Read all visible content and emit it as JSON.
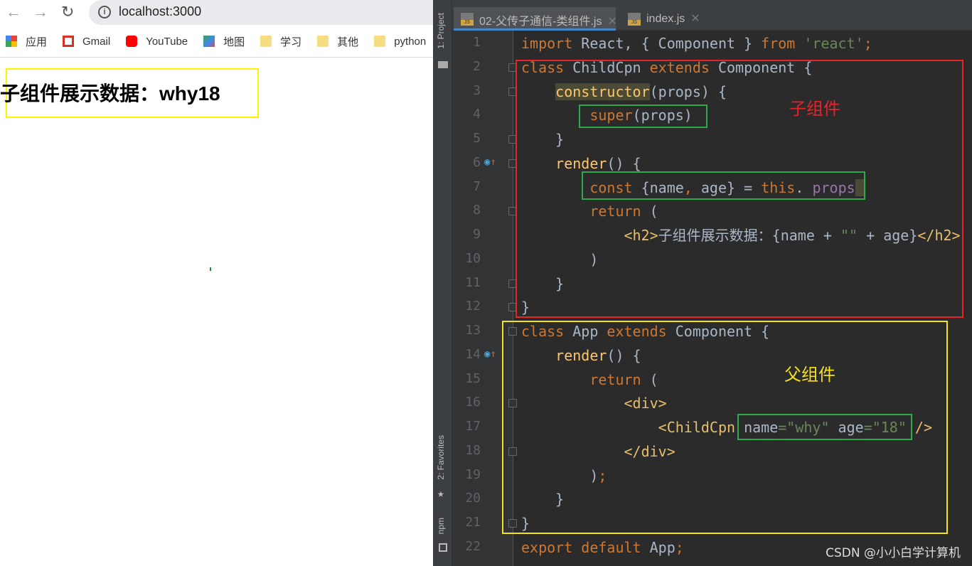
{
  "browser": {
    "url": "localhost:3000",
    "bookmarks": [
      {
        "label": "应用",
        "icon": "apps-icon"
      },
      {
        "label": "Gmail",
        "icon": "gmail-icon"
      },
      {
        "label": "YouTube",
        "icon": "youtube-icon"
      },
      {
        "label": "地图",
        "icon": "maps-icon"
      },
      {
        "label": "学习",
        "icon": "folder-icon"
      },
      {
        "label": "其他",
        "icon": "folder-icon"
      },
      {
        "label": "python",
        "icon": "folder-icon"
      }
    ],
    "page_heading": "子组件展示数据：why18"
  },
  "ide": {
    "side_labels": {
      "project": "1: Project",
      "favorites": "2: Favorites",
      "npm": "npm"
    },
    "tabs": [
      {
        "label": "02-父传子通信-类组件.js",
        "active": true
      },
      {
        "label": "index.js",
        "active": false
      }
    ],
    "lines": [
      [
        [
          "k",
          "import "
        ],
        [
          "",
          "React, { Component } "
        ],
        [
          "k",
          "from "
        ],
        [
          "s",
          "'react'"
        ],
        [
          "k",
          ";"
        ]
      ],
      [
        [
          "k",
          "class "
        ],
        [
          "",
          "ChildCpn "
        ],
        [
          "k",
          "extends "
        ],
        [
          "",
          "Component {"
        ]
      ],
      [
        [
          "",
          "    "
        ],
        [
          "f hl",
          "constructor"
        ],
        [
          "",
          "(props) {"
        ]
      ],
      [
        [
          "",
          "        "
        ],
        [
          "k",
          "super"
        ],
        [
          "",
          "(props)"
        ]
      ],
      [
        [
          "",
          "    }"
        ]
      ],
      [
        [
          "",
          "    "
        ],
        [
          "f",
          "render"
        ],
        [
          "",
          "() {"
        ]
      ],
      [
        [
          "",
          "        "
        ],
        [
          "k",
          "const "
        ],
        [
          "",
          "{name"
        ],
        [
          "k",
          ", "
        ],
        [
          "",
          "age} = "
        ],
        [
          "k",
          "this"
        ],
        [
          "",
          ". "
        ],
        [
          "p",
          "props"
        ],
        [
          "hl",
          " "
        ]
      ],
      [
        [
          "",
          "        "
        ],
        [
          "k",
          "return "
        ],
        [
          "",
          "("
        ]
      ],
      [
        [
          "",
          "            "
        ],
        [
          "t",
          "<h2>"
        ],
        [
          "",
          "子组件展示数据：{name + "
        ],
        [
          "s",
          "\"\""
        ],
        [
          "",
          " + age}"
        ],
        [
          "t",
          "</h2>"
        ]
      ],
      [
        [
          "",
          "        )"
        ]
      ],
      [
        [
          "",
          "    }"
        ]
      ],
      [
        [
          "",
          "}"
        ]
      ],
      [
        [
          "k",
          "class "
        ],
        [
          "",
          "App "
        ],
        [
          "k",
          "extends "
        ],
        [
          "",
          "Component {"
        ]
      ],
      [
        [
          "",
          "    "
        ],
        [
          "f",
          "render"
        ],
        [
          "",
          "() {"
        ]
      ],
      [
        [
          "",
          "        "
        ],
        [
          "k",
          "return "
        ],
        [
          "",
          "("
        ]
      ],
      [
        [
          "",
          "            "
        ],
        [
          "t",
          "<div>"
        ]
      ],
      [
        [
          "",
          "                "
        ],
        [
          "t",
          "<ChildCpn "
        ],
        [
          "",
          "name"
        ],
        [
          "s",
          "=\"why\" "
        ],
        [
          "",
          "age"
        ],
        [
          "s",
          "=\"18\" "
        ],
        [
          "t",
          "/>"
        ]
      ],
      [
        [
          "",
          "            "
        ],
        [
          "t",
          "</div>"
        ]
      ],
      [
        [
          "",
          "        )"
        ],
        [
          "k",
          ";"
        ]
      ],
      [
        [
          "",
          "    }"
        ]
      ],
      [
        [
          "",
          "}"
        ]
      ],
      [
        [
          "k",
          "export default "
        ],
        [
          "",
          "App"
        ],
        [
          "k",
          ";"
        ]
      ]
    ],
    "fold_lines": [
      2,
      3,
      5,
      6,
      8,
      11,
      12,
      13,
      16,
      18,
      21
    ],
    "override_icon_lines": [
      6,
      14
    ]
  },
  "annotations": {
    "child": "子组件",
    "parent": "父组件",
    "child_color": "#e8232a",
    "parent_color": "#f5e11c",
    "highlight_color": "#2eaa4a"
  },
  "watermark": "CSDN @小小白学计算机"
}
